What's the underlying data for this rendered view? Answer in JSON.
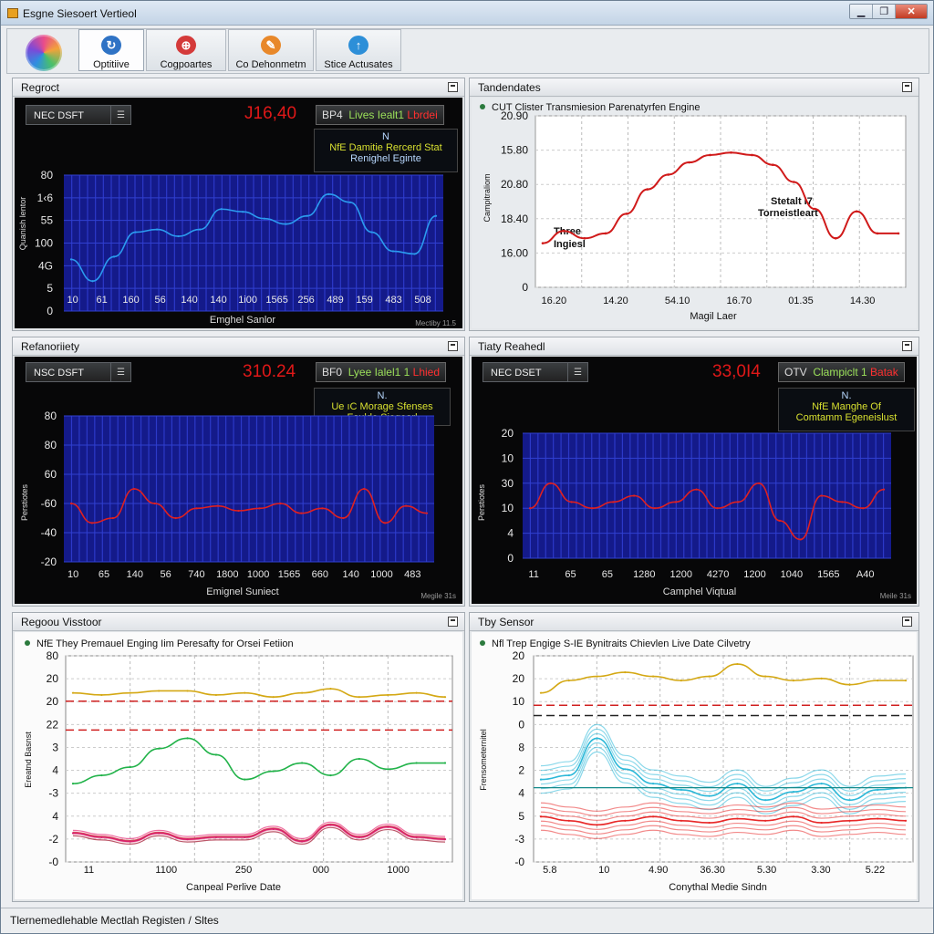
{
  "window": {
    "title": "Esgne Siesoert Vertieol",
    "controls": {
      "minimize": "▁",
      "maximize": "❐",
      "close": "✕"
    }
  },
  "toolbar": {
    "logo_icon": "app-logo-icon",
    "buttons": [
      {
        "label": "Optitiive",
        "icon": "chart-icon",
        "icon_glyph": "↻",
        "color": "#2f73c5"
      },
      {
        "label": "Cogpoartes",
        "icon": "gauge-icon",
        "icon_glyph": "⊕",
        "color": "#d43a3a"
      },
      {
        "label": "Co Dehonmetm",
        "icon": "wrench-icon",
        "icon_glyph": "✎",
        "color": "#e8882a"
      },
      {
        "label": "Stice Actusates",
        "icon": "actuator-icon",
        "icon_glyph": "↑",
        "color": "#2d8fd8"
      }
    ]
  },
  "panels": {
    "p1": {
      "title": "Regroct",
      "select": "NEC DSFT",
      "value": "J16,40",
      "tag": {
        "label": "BP4",
        "text": "Lives Iealt1 ",
        "red": "Lbrdei"
      },
      "info": {
        "small": "N",
        "line1": "NfE Damitie Rercerd Stat",
        "line2": "Renighel Eginte"
      },
      "xlabel": "Emghel Sanlor",
      "watermark": "Mectiby 11.5",
      "chart_data": {
        "type": "line",
        "title": "",
        "xlabel": "Emghel Sanlor",
        "ylabel": "Quanish lentor",
        "yticks": [
          "80",
          "1‹6",
          "55",
          "100",
          "4G",
          "5",
          "0"
        ],
        "xticks": [
          "10",
          "61",
          "160",
          "56",
          "140",
          "140",
          "1i00",
          "1565",
          "256",
          "489",
          "159",
          "483",
          "508"
        ],
        "series": [
          {
            "name": "",
            "color": "#2b9bef",
            "values": [
              38,
              22,
              40,
              58,
              60,
              55,
              60,
              75,
              73,
              68,
              64,
              70,
              86,
              80,
              58,
              44,
              42,
              70
            ]
          }
        ]
      }
    },
    "p2": {
      "title": "Tandendates",
      "legend": "CUT Clister Transmiesion Parenatyrfen Engine",
      "annot1": "Three",
      "annot2": "Ingiesl",
      "annot3": "Stetalt I7",
      "annot4": "Torneistleart",
      "chart_data": {
        "type": "scatter",
        "title": "",
        "xlabel": "Magil Laer",
        "ylabel": "Campitraliom",
        "yticks": [
          "20.90",
          "15.80",
          "20.80",
          "18.40",
          "16.00",
          "0"
        ],
        "xticks": [
          "16.20",
          "14.20",
          "54.10",
          "16.70",
          "01.35",
          "14.30"
        ],
        "series": [
          {
            "name": "",
            "color": "#d01a1a",
            "values": [
              16.8,
              17.3,
              17.0,
              17.2,
              18.0,
              19.0,
              19.6,
              20.1,
              20.4,
              20.5,
              20.4,
              20.0,
              19.3,
              18.2,
              17.0,
              18.1,
              17.2,
              17.2
            ]
          }
        ]
      }
    },
    "p3": {
      "title": "Refanoriiety",
      "select": "NSC DSFT",
      "value": "310.24",
      "tag": {
        "label": "BF0",
        "text": "Lyee Ialel1 1 ",
        "red": "Lhied"
      },
      "info": {
        "small": "N.",
        "line1": "Ue ıC Morage Sfenses",
        "line2": "Foulde Sieqearl"
      },
      "xlabel": "Emignel Suniect",
      "watermark": "Megile 31s",
      "chart_data": {
        "type": "line",
        "title": "",
        "xlabel": "Emignel Suniect",
        "ylabel": "Perstiotes",
        "yticks": [
          "80",
          "80",
          "60",
          "-60",
          "-40",
          "-20"
        ],
        "xticks": [
          "10",
          "65",
          "140",
          "56",
          "740",
          "1800",
          "1000",
          "1565",
          "660",
          "140",
          "1000",
          "483"
        ],
        "series": [
          {
            "name": "",
            "color": "#e02020",
            "values": [
              -56,
              -64,
              -62,
              -50,
              -56,
              -62,
              -58,
              -57,
              -59,
              -58,
              -56,
              -60,
              -58,
              -62,
              -50,
              -64,
              -57,
              -60
            ]
          }
        ]
      }
    },
    "p4": {
      "title": "Tiaty Reahedl",
      "select": "NEC DSET",
      "value": "33,0I4",
      "tag": {
        "label": "OTV",
        "text": "Clampiclt 1 ",
        "red": "Batak"
      },
      "info": {
        "small": "N.",
        "line1": "NfE Manghe Of",
        "line2": "Comtamm Egeneislust"
      },
      "xlabel": "Camphel Viqtual",
      "watermark": "Meile 31s",
      "chart_data": {
        "type": "line",
        "title": "",
        "xlabel": "Camphel Viqtual",
        "ylabel": "Perstiotes",
        "yticks": [
          "20",
          "10",
          "30",
          "10",
          "4",
          "0"
        ],
        "xticks": [
          "11",
          "65",
          "65",
          "1280",
          "1200",
          "4270",
          "1200",
          "1040",
          "1565",
          "A40"
        ],
        "series": [
          {
            "name": "",
            "color": "#e02020",
            "values": [
              8,
              12,
              9,
              8,
              9,
              10,
              8,
              9,
              11,
              8,
              9,
              12,
              6,
              3,
              10,
              9,
              8,
              11
            ]
          }
        ]
      }
    },
    "p5": {
      "title": "Regoou Visstoor",
      "legend": "NfE They Premauel Enging Iim Peresafty for Orsei Fetiion",
      "chart_data": {
        "type": "line",
        "title": "",
        "xlabel": "Canpeal Perlive Date",
        "ylabel": "Ereatnd Basnst",
        "yticks": [
          "80",
          "20",
          "20",
          "22",
          "3",
          "4",
          "-3",
          "4",
          "-2",
          "-0"
        ],
        "xticks": [
          "11",
          "1100",
          "250",
          "000",
          "1000"
        ],
        "series": [
          {
            "name": "",
            "color": "#d4a814",
            "values": [
              82,
              81,
              82,
              83,
              83,
              81,
              82,
              80,
              82,
              84,
              80,
              81,
              82,
              80
            ]
          },
          {
            "name": "",
            "color": "#22b34a",
            "values": [
              38,
              42,
              46,
              55,
              60,
              52,
              40,
              44,
              48,
              42,
              50,
              45,
              48,
              48
            ]
          },
          {
            "name": "",
            "color": "#d8206a",
            "values": [
              14,
              12,
              10,
              14,
              11,
              12,
              12,
              16,
              10,
              18,
              12,
              17,
              12,
              11
            ]
          }
        ]
      }
    },
    "p6": {
      "title": "Tby Sensor",
      "legend": "Nfl Trep Engige S-IE Bynitraits Chievlen Live Date Cilvetry",
      "chart_data": {
        "type": "line",
        "title": "",
        "xlabel": "Conythal Medie Sindn",
        "ylabel": "Frensometernitel",
        "yticks": [
          "20",
          "20",
          "10",
          "0",
          "8",
          "2",
          "4",
          "5",
          "-3",
          "-0"
        ],
        "xticks": [
          "5.8",
          "10",
          "4.90",
          "36.30",
          "5.30",
          "3.30",
          "5.22"
        ],
        "series": [
          {
            "name": "",
            "color": "#d4a814",
            "values": [
              82,
              88,
              90,
              92,
              90,
              88,
              90,
              96,
              90,
              88,
              89,
              86,
              88,
              88
            ]
          },
          {
            "name": "",
            "color": "#2cb8d8",
            "values": [
              40,
              42,
              60,
              45,
              38,
              35,
              32,
              38,
              30,
              34,
              38,
              30,
              35,
              36
            ]
          },
          {
            "name": "",
            "color": "#e82828",
            "values": [
              22,
              20,
              18,
              20,
              22,
              20,
              19,
              21,
              20,
              22,
              19,
              20,
              21,
              20
            ]
          }
        ]
      }
    }
  },
  "statusbar": {
    "text": "Tlernemedlehable Mectlah Registen / Sltes"
  }
}
